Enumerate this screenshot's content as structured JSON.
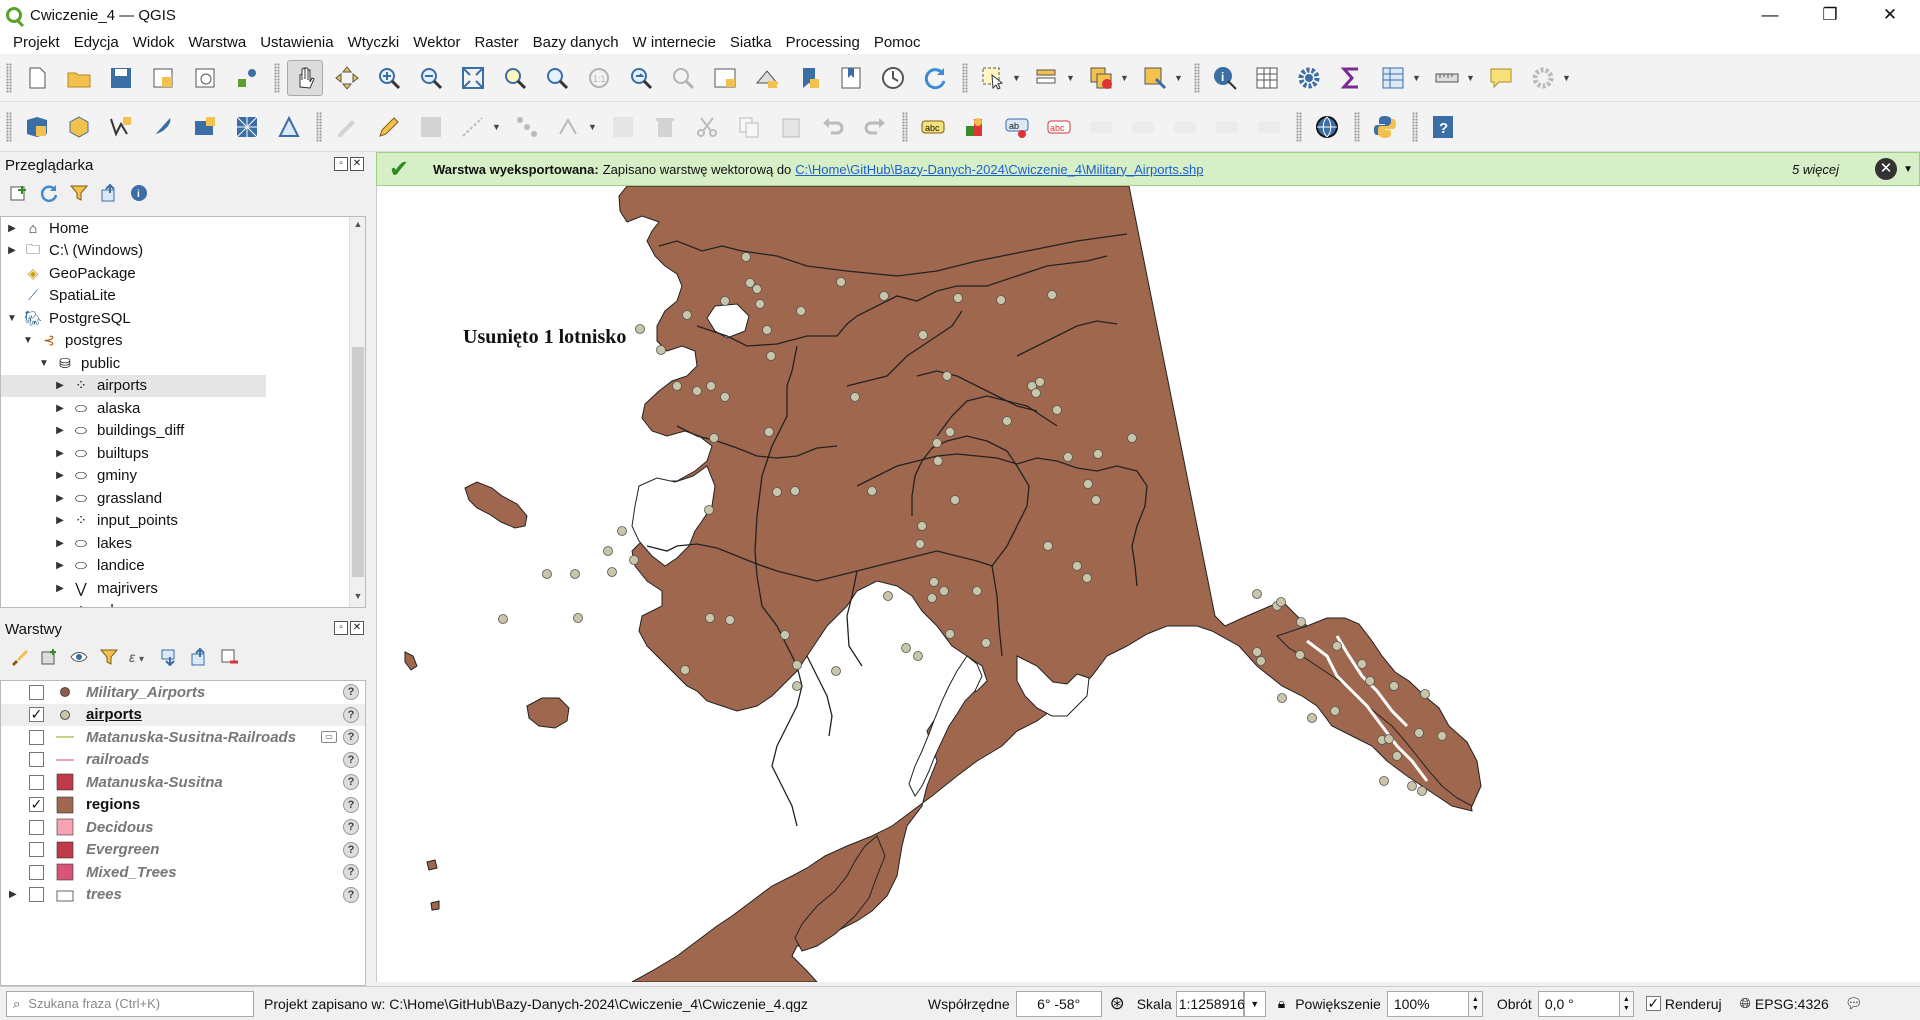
{
  "window": {
    "title": "Cwiczenie_4 — QGIS",
    "minimize": "—",
    "restore": "❐",
    "close": "✕"
  },
  "menu": [
    "Projekt",
    "Edycja",
    "Widok",
    "Warstwa",
    "Ustawienia",
    "Wtyczki",
    "Wektor",
    "Raster",
    "Bazy danych",
    "W internecie",
    "Siatka",
    "Processing",
    "Pomoc"
  ],
  "browser": {
    "title": "Przeglądarka",
    "items": [
      {
        "label": "Home",
        "icon": "home-icon",
        "arrow": "▶",
        "indent": 0
      },
      {
        "label": "C:\\ (Windows)",
        "icon": "folder-icon",
        "arrow": "▶",
        "indent": 0
      },
      {
        "label": "GeoPackage",
        "icon": "geopackage-icon",
        "arrow": "",
        "indent": 0
      },
      {
        "label": "SpatiaLite",
        "icon": "spatialite-icon",
        "arrow": "",
        "indent": 0
      },
      {
        "label": "PostgreSQL",
        "icon": "postgresql-icon",
        "arrow": "▼",
        "indent": 0
      },
      {
        "label": "postgres",
        "icon": "connection-icon",
        "arrow": "▼",
        "indent": 1
      },
      {
        "label": "public",
        "icon": "schema-icon",
        "arrow": "▼",
        "indent": 2
      },
      {
        "label": "airports",
        "icon": "point-layer-icon",
        "arrow": "▶",
        "indent": 3
      },
      {
        "label": "alaska",
        "icon": "polygon-layer-icon",
        "arrow": "▶",
        "indent": 3
      },
      {
        "label": "buildings_diff",
        "icon": "polygon-layer-icon",
        "arrow": "▶",
        "indent": 3
      },
      {
        "label": "builtups",
        "icon": "polygon-layer-icon",
        "arrow": "▶",
        "indent": 3
      },
      {
        "label": "gminy",
        "icon": "polygon-layer-icon",
        "arrow": "▶",
        "indent": 3
      },
      {
        "label": "grassland",
        "icon": "polygon-layer-icon",
        "arrow": "▶",
        "indent": 3
      },
      {
        "label": "input_points",
        "icon": "point-layer-icon",
        "arrow": "▶",
        "indent": 3
      },
      {
        "label": "lakes",
        "icon": "polygon-layer-icon",
        "arrow": "▶",
        "indent": 3
      },
      {
        "label": "landice",
        "icon": "polygon-layer-icon",
        "arrow": "▶",
        "indent": 3
      },
      {
        "label": "majrivers",
        "icon": "line-layer-icon",
        "arrow": "▶",
        "indent": 3
      },
      {
        "label": "nd",
        "icon": "point-layer-icon",
        "arrow": "▶",
        "indent": 3
      }
    ]
  },
  "layers": {
    "title": "Warstwy",
    "items": [
      {
        "label": "Military_Airports",
        "checked": false,
        "symbol": "point",
        "color": "#8b5e4b",
        "expand": ""
      },
      {
        "label": "airports",
        "checked": true,
        "symbol": "point",
        "color": "#c8c5a8",
        "expand": ""
      },
      {
        "label": "Matanuska-Susitna-Railroads",
        "checked": false,
        "symbol": "line",
        "color": "#c8d28a",
        "expand": ""
      },
      {
        "label": "railroads",
        "checked": false,
        "symbol": "line",
        "color": "#e8a8b0",
        "expand": ""
      },
      {
        "label": "Matanuska-Susitna",
        "checked": false,
        "symbol": "fill",
        "color": "#c0394b",
        "expand": ""
      },
      {
        "label": "regions",
        "checked": true,
        "symbol": "fill",
        "color": "#a0674f",
        "expand": ""
      },
      {
        "label": "Decidous",
        "checked": false,
        "symbol": "fill",
        "color": "#f4a3b4",
        "expand": ""
      },
      {
        "label": "Evergreen",
        "checked": false,
        "symbol": "fill",
        "color": "#c0394b",
        "expand": ""
      },
      {
        "label": "Mixed_Trees",
        "checked": false,
        "symbol": "fill",
        "color": "#d9547a",
        "expand": ""
      },
      {
        "label": "trees",
        "checked": false,
        "symbol": "group",
        "color": "#888888",
        "expand": "▶"
      }
    ]
  },
  "message": {
    "title": "Warstwa wyeksportowana:",
    "text": "Zapisano warstwę wektorową do",
    "link": "C:\\Home\\GitHub\\Bazy-Danych-2024\\Cwiczenie_4\\Military_Airports.shp",
    "more": "5 więcej",
    "close": "✕"
  },
  "map": {
    "label": "Usunięto 1 lotnisko",
    "fill_color": "#a0674f",
    "airport_color": "#c8c5a8"
  },
  "status": {
    "search_placeholder": "Szukana fraza (Ctrl+K)",
    "project_saved": "Projekt zapisano w: C:\\Home\\GitHub\\Bazy-Danych-2024\\Cwiczenie_4\\Cwiczenie_4.qgz",
    "coord_label": "Współrzędne",
    "coord_value": "6° -58°",
    "scale_label": "Skala",
    "scale_value": "1:1258916",
    "magnifier_label": "Powiększenie",
    "magnifier_value": "100%",
    "rotation_label": "Obrót",
    "rotation_value": "0,0 °",
    "render_label": "Renderuj",
    "crs": "EPSG:4326"
  }
}
